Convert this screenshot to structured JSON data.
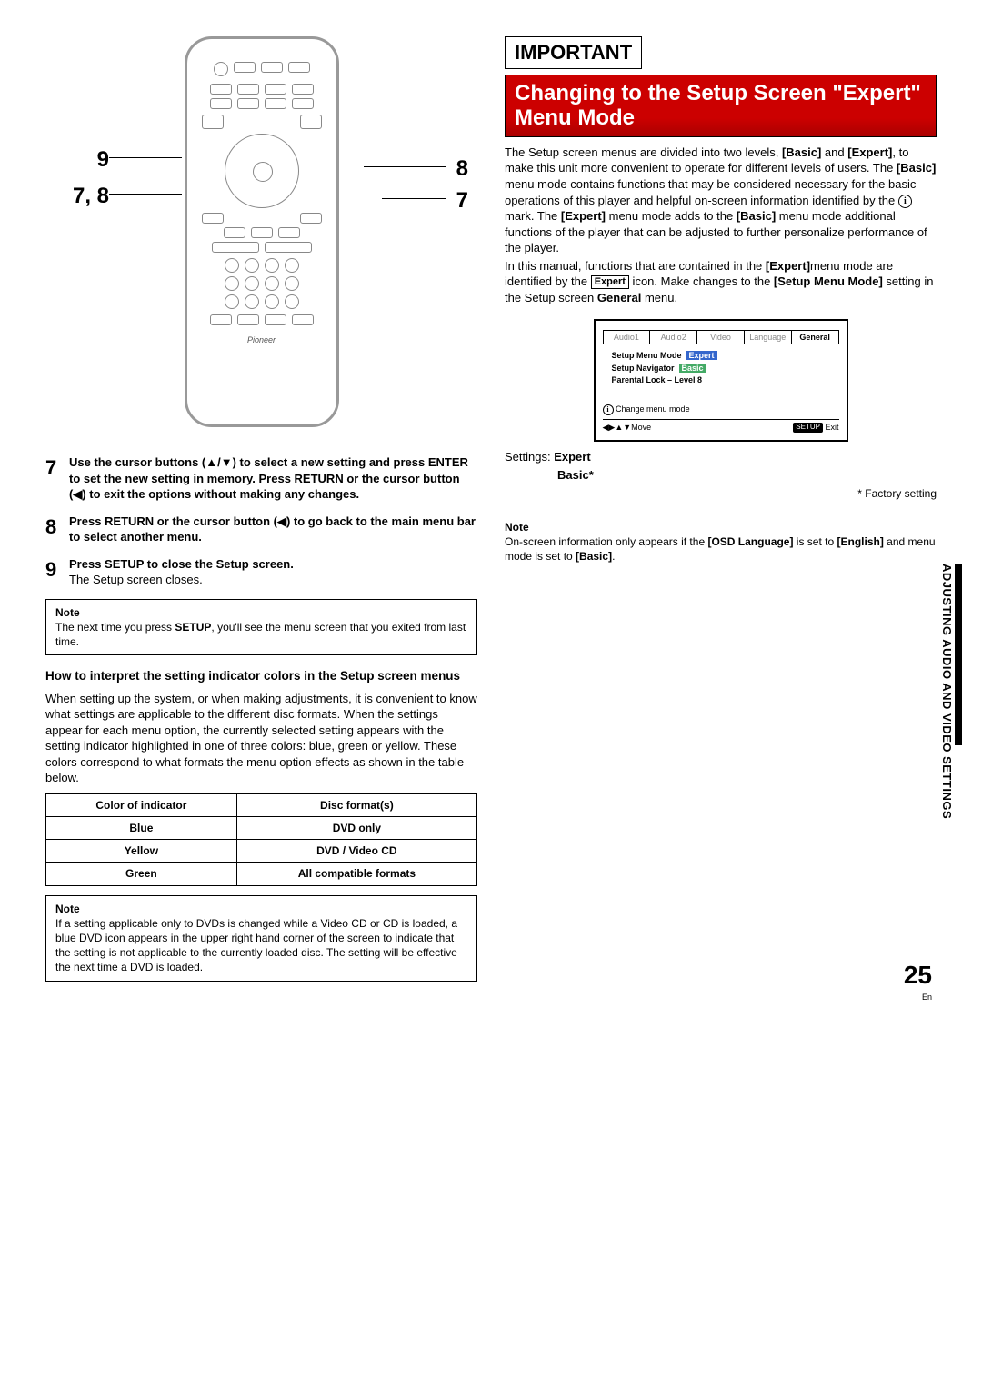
{
  "sideText": "ADJUSTING AUDIO AND VIDEO SETTINGS",
  "pageNumber": "25",
  "pageLang": "En",
  "remote": {
    "callouts": {
      "left9": "9",
      "left78": "7, 8",
      "right8": "8",
      "right7": "7"
    },
    "logo": "Pioneer"
  },
  "steps": [
    {
      "num": "7",
      "bold": "Use the cursor buttons (▲/▼) to select a new  setting and press ENTER to set the new setting in memory. Press RETURN or the cursor button (◀) to exit the options without making any changes."
    },
    {
      "num": "8",
      "bold": "Press RETURN or the cursor button (◀) to go back to the main menu bar to select another menu."
    },
    {
      "num": "9",
      "bold": "Press SETUP to close the Setup screen.",
      "plain": "The Setup screen closes."
    }
  ],
  "note1": {
    "title": "Note",
    "text1": "The next time you press ",
    "textBold": "SETUP",
    "text2": ", you'll see the menu screen that you exited from last time."
  },
  "colors": {
    "heading": "How to interpret the setting indicator colors in the Setup screen menus",
    "body": "When setting up the system, or when making adjustments, it is convenient to know what settings are applicable to the different disc formats. When the settings appear for each menu option, the currently selected setting appears with the setting indicator highlighted in one of three colors: blue, green or yellow. These colors correspond to what formats the menu option effects as shown in the table below.",
    "th1": "Color of indicator",
    "th2": "Disc format(s)",
    "rows": [
      {
        "c": "Blue",
        "f": "DVD only"
      },
      {
        "c": "Yellow",
        "f": "DVD / Video CD"
      },
      {
        "c": "Green",
        "f": "All compatible formats"
      }
    ]
  },
  "note2": {
    "title": "Note",
    "text": "If a setting applicable only to DVDs is changed while a Video CD or CD is loaded, a blue DVD icon appears in the upper right hand corner of the screen to indicate that the setting is not applicable to the currently loaded disc. The setting will be effective the next time a DVD is loaded."
  },
  "important": "IMPORTANT",
  "redTitle": "Changing to the Setup Screen \"Expert\" Menu Mode",
  "rightBody": {
    "p1a": "The Setup screen menus are divided into two levels, ",
    "p1b": "[Basic]",
    "p1c": " and ",
    "p1d": "[Expert]",
    "p1e": ", to make this unit more convenient to operate for different levels of users. The ",
    "p1f": "[Basic]",
    "p1g": " menu mode contains functions that may be considered necessary for the basic operations of this player and helpful on-screen information identified by the ",
    "p1h": " mark. The ",
    "p1i": "[Expert]",
    "p1j": " menu mode adds to the ",
    "p1k": "[Basic]",
    "p1l": " menu mode additional functions of the player that can be adjusted to further personalize performance of the player.",
    "p2a": "In this manual, functions that are contained in the ",
    "p2b": "[Expert]",
    "p2c": "menu mode are identified by the ",
    "p2d": "Expert",
    "p2e": " icon. Make changes to the ",
    "p2f": "[Setup Menu Mode]",
    "p2g": " setting in the Setup screen ",
    "p2h": "General",
    "p2i": " menu."
  },
  "osd": {
    "tabs": [
      "Audio1",
      "Audio2",
      "Video",
      "Language",
      "General"
    ],
    "lines": [
      {
        "label": "Setup Menu Mode",
        "value": "Expert",
        "cls": "blue"
      },
      {
        "label": "Setup Navigator",
        "value": "Basic",
        "cls": ""
      },
      {
        "label": "Parental Lock – Level 8",
        "value": "",
        "cls": ""
      }
    ],
    "help": "Change menu mode",
    "footerMove": "Move",
    "footerSetup": "SETUP",
    "footerExit": "Exit"
  },
  "settings": {
    "label": "Settings:",
    "v1": "Expert",
    "v2": "Basic*",
    "factory": "* Factory setting"
  },
  "note3": {
    "title": "Note",
    "t1": "On-screen information only appears if the ",
    "b1": "[OSD Language]",
    "t2": " is set to ",
    "b2": "[English]",
    "t3": " and menu mode is set to ",
    "b3": "[Basic]",
    "t4": "."
  }
}
